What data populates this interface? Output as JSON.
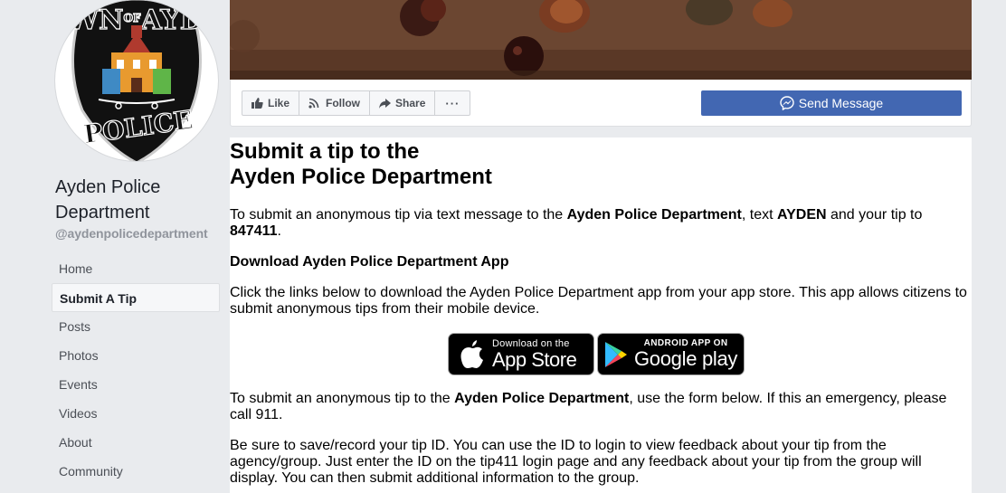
{
  "profile": {
    "logo_text_top": "TOWN",
    "logo_text_of": "OF",
    "logo_text_name": "AYDEN",
    "logo_text_bottom": "POLICE",
    "name": "Ayden Police Department",
    "handle": "@aydenpolicedepartment"
  },
  "sidebar": {
    "items": [
      {
        "label": "Home",
        "active": false
      },
      {
        "label": "Submit A Tip",
        "active": true
      },
      {
        "label": "Posts",
        "active": false
      },
      {
        "label": "Photos",
        "active": false
      },
      {
        "label": "Events",
        "active": false
      },
      {
        "label": "Videos",
        "active": false
      },
      {
        "label": "About",
        "active": false
      },
      {
        "label": "Community",
        "active": false
      }
    ]
  },
  "actions": {
    "like_label": "Like",
    "follow_label": "Follow",
    "share_label": "Share",
    "more_label": "···",
    "send_message_label": "Send Message"
  },
  "content": {
    "title_line1": "Submit a tip to the",
    "title_line2": "Ayden Police Department",
    "p1_a": "To submit an anonymous tip via text message to the ",
    "p1_b": "Ayden Police Department",
    "p1_c": ", text ",
    "p1_d": "AYDEN",
    "p1_e": " and your tip to ",
    "p1_f": "847411",
    "p1_g": ".",
    "app_heading": "Download Ayden Police Department App",
    "p2": "Click the links below to download the Ayden Police Department app from your app store.  This app allows citizens to submit anonymous tips from their mobile device.",
    "appstore_small": "Download on the",
    "appstore_big": "App Store",
    "googleplay_small": "ANDROID APP ON",
    "googleplay_big": "Google play",
    "p3_a": "To submit an anonymous tip to the ",
    "p3_b": "Ayden Police Department",
    "p3_c": ", use the form below. If this an emergency, please call 911.",
    "p4": "Be sure to save/record your tip ID. You can use the ID to login to view feedback about your tip from the agency/group. Just enter the ID on the tip411 login page and any feedback about your tip from the group will display. You can then submit additional information to the group."
  },
  "colors": {
    "brand_blue": "#4267b2",
    "page_bg": "#e9ebee"
  }
}
